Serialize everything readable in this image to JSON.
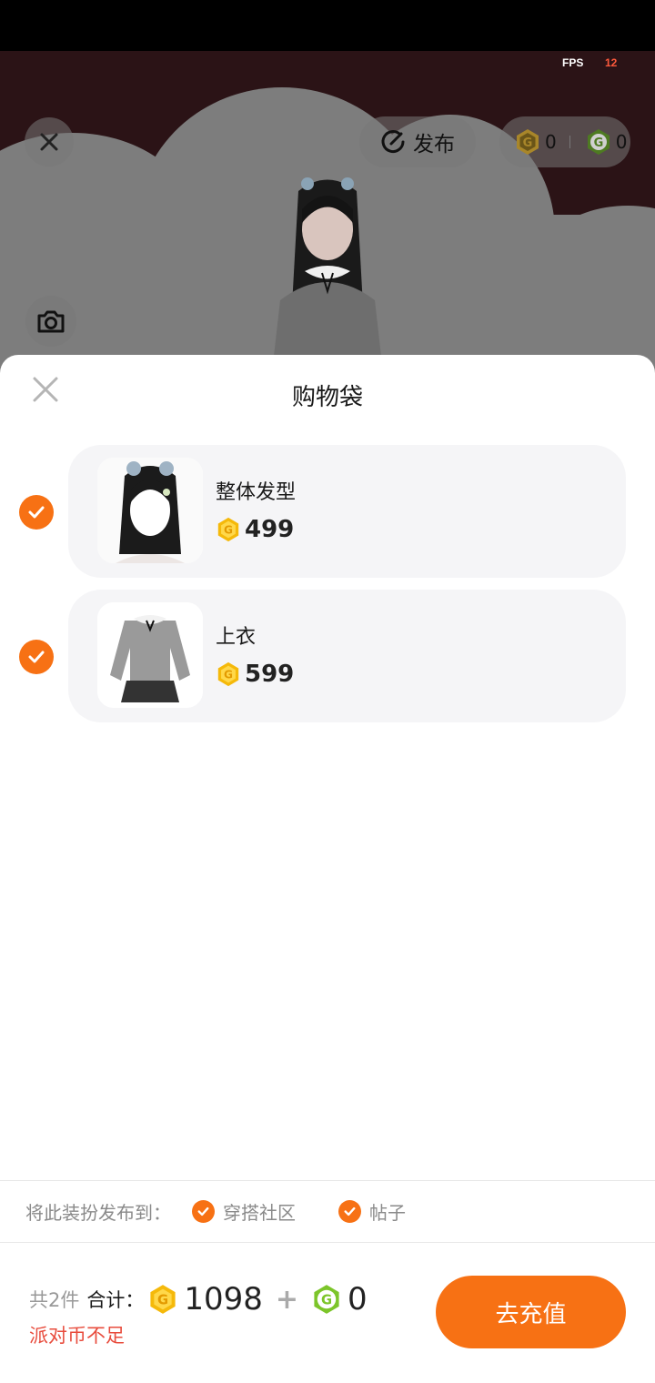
{
  "hud": {
    "fps_label": "FPS",
    "fps_value": "12",
    "publish_label": "发布",
    "gold_balance": "0",
    "green_balance": "0"
  },
  "sheet": {
    "title": "购物袋",
    "items": [
      {
        "name": "整体发型",
        "price": "499",
        "checked": true,
        "thumb_icon": "hairstyle-thumbnail"
      },
      {
        "name": "上衣",
        "price": "599",
        "checked": true,
        "thumb_icon": "top-thumbnail"
      }
    ]
  },
  "publish": {
    "label": "将此装扮发布到：",
    "options": [
      {
        "label": "穿搭社区",
        "checked": true
      },
      {
        "label": "帖子",
        "checked": true
      }
    ]
  },
  "footer": {
    "count": "共2件",
    "sum_label": "合计：",
    "gold_total": "1098",
    "plus": "+",
    "green_total": "0",
    "warning": "派对币不足",
    "recharge_label": "去充值"
  },
  "colors": {
    "accent": "#f77114",
    "warning": "#e84c3d",
    "gold_coin": "#f5b90a",
    "green_coin": "#7cc52a"
  }
}
